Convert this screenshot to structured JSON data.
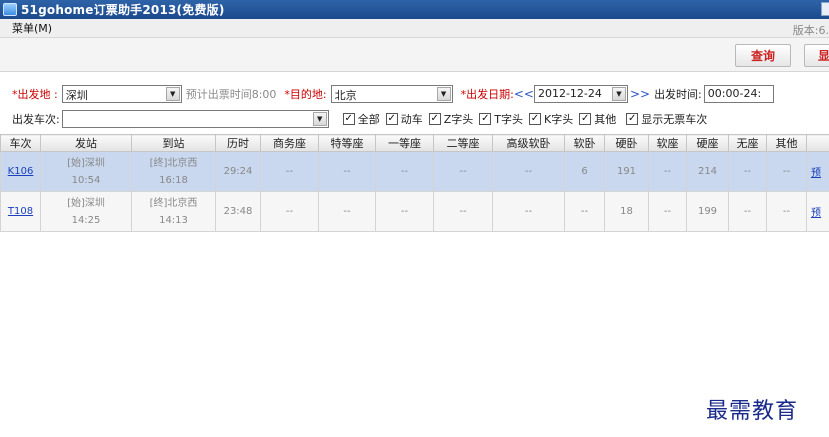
{
  "window": {
    "title": "51gohome订票助手2013(免费版)"
  },
  "menubar": {
    "menu": "菜单(M)",
    "version": "版本:6."
  },
  "toolbar": {
    "query": "查询",
    "more": "显"
  },
  "filter": {
    "from_star": "*",
    "from_label": "出发地 :",
    "from_value": "深圳",
    "estimate": "预计出票时间8:00",
    "to_star": "*",
    "to_label": "目的地:",
    "to_value": "北京",
    "date_star": "*",
    "date_label": "出发日期:",
    "date_prev": "<<",
    "date_value": "2012-12-24",
    "date_next": ">>",
    "time_label": "出发时间:",
    "time_value": "00:00-24:",
    "train_label": "出发车次:",
    "train_value": "",
    "checkboxes": [
      "全部",
      "动车",
      "Z字头",
      "T字头",
      "K字头",
      "其他",
      "显示无票车次"
    ]
  },
  "table": {
    "columns": [
      "车次",
      "发站",
      "到站",
      "历时",
      "商务座",
      "特等座",
      "一等座",
      "二等座",
      "高级软卧",
      "软卧",
      "硬卧",
      "软座",
      "硬座",
      "无座",
      "其他",
      ""
    ],
    "rows": [
      {
        "train": "K106",
        "from_station": "[始]深圳",
        "from_time": "10:54",
        "to_station": "[终]北京西",
        "to_time": "16:18",
        "duration": "29:24",
        "seats": [
          "--",
          "--",
          "--",
          "--",
          "--",
          "6",
          "191",
          "--",
          "214",
          "--",
          "--"
        ],
        "book": "预"
      },
      {
        "train": "T108",
        "from_station": "[始]深圳",
        "from_time": "14:25",
        "to_station": "[终]北京西",
        "to_time": "14:13",
        "duration": "23:48",
        "seats": [
          "--",
          "--",
          "--",
          "--",
          "--",
          "--",
          "18",
          "--",
          "199",
          "--",
          "--"
        ],
        "book": "预"
      }
    ]
  },
  "watermark": "最需教育"
}
